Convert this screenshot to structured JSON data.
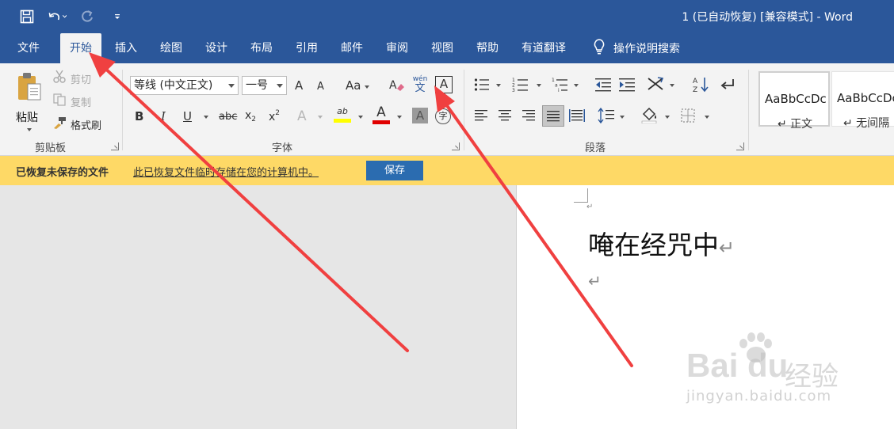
{
  "title_bar": {
    "doc_title": "1 (已自动恢复) [兼容模式]  -  Word"
  },
  "tabs": [
    {
      "label": "文件"
    },
    {
      "label": "开始",
      "active": true
    },
    {
      "label": "插入"
    },
    {
      "label": "绘图"
    },
    {
      "label": "设计"
    },
    {
      "label": "布局"
    },
    {
      "label": "引用"
    },
    {
      "label": "邮件"
    },
    {
      "label": "审阅"
    },
    {
      "label": "视图"
    },
    {
      "label": "帮助"
    },
    {
      "label": "有道翻译"
    }
  ],
  "tell_me": {
    "label": "操作说明搜索"
  },
  "clipboard": {
    "paste_label": "粘贴",
    "cut_label": "剪切",
    "copy_label": "复制",
    "format_painter_label": "格式刷",
    "group_label": "剪贴板"
  },
  "font": {
    "font_name": "等线 (中文正文)",
    "font_size": "一号",
    "group_label": "字体",
    "grow_glyph": "A",
    "shrink_glyph": "A",
    "case_glyph": "Aa",
    "phonetic_top": "wén",
    "phonetic_bottom": "文",
    "border_glyph": "A",
    "bold_glyph": "B",
    "italic_glyph": "I",
    "underline_glyph": "U",
    "strike_glyph": "abc",
    "sub_glyph": "x",
    "sub_mark": "2",
    "sup_glyph": "x",
    "sup_mark": "2",
    "effects_glyph": "A",
    "highlight_glyph": "ab",
    "font_color_glyph": "A",
    "shade_glyph": "A",
    "enclose_glyph": "字"
  },
  "paragraph": {
    "group_label": "段落"
  },
  "styles": [
    {
      "sample": "AaBbCcDc",
      "name": "↵ 正文"
    },
    {
      "sample": "AaBbCcDc",
      "name": "↵ 无间隔"
    }
  ],
  "message_bar": {
    "title": "已恢复未保存的文件",
    "text": "此已恢复文件临时存储在您的计算机中。",
    "button": "保存"
  },
  "document": {
    "para_mark": "↵",
    "line2": "唵在经咒中"
  },
  "watermark": {
    "logo": "Bai du",
    "cn": "经验",
    "url": "jingyan.baidu.com"
  },
  "colors": {
    "brand": "#2b579a",
    "message_bar": "#fed966",
    "save_button": "#2b6cb0",
    "arrow": "#f04040",
    "highlight_yellow": "#ffff00",
    "font_color_red": "#e00000"
  }
}
